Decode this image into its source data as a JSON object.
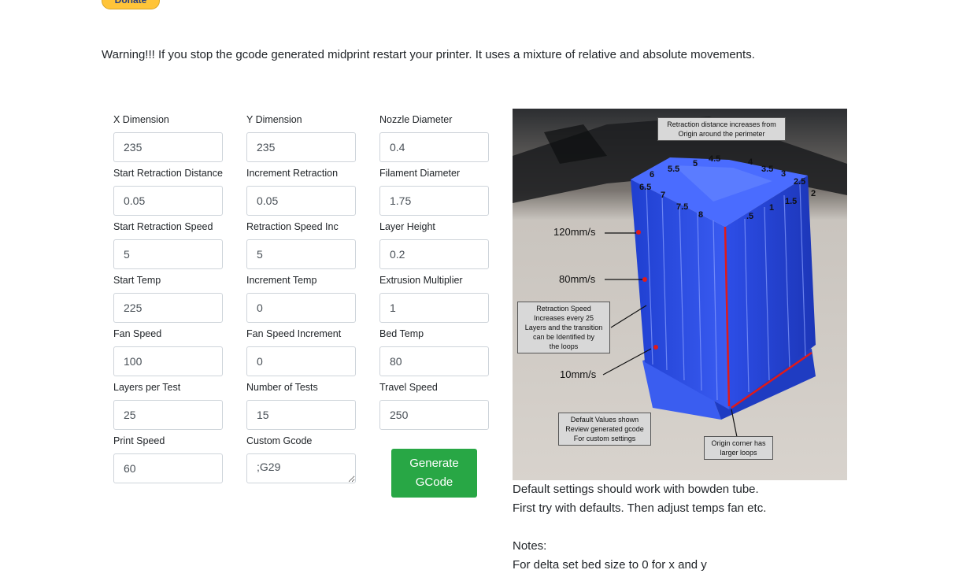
{
  "donate": {
    "label": "Donate"
  },
  "warning": "Warning!!! If you stop the gcode generated midprint restart your printer. It uses a mixture of relative and absolute movements.",
  "columns": [
    [
      {
        "label": "X Dimension",
        "value": "235"
      },
      {
        "label": "Start Retraction Distance",
        "value": "0.05"
      },
      {
        "label": "Start Retraction Speed",
        "value": "5"
      },
      {
        "label": "Start Temp",
        "value": "225"
      },
      {
        "label": "Fan Speed",
        "value": "100"
      },
      {
        "label": "Layers per Test",
        "value": "25"
      },
      {
        "label": "Print Speed",
        "value": "60"
      }
    ],
    [
      {
        "label": "Y Dimension",
        "value": "235"
      },
      {
        "label": "Increment Retraction",
        "value": "0.05"
      },
      {
        "label": "Retraction Speed Inc",
        "value": "5"
      },
      {
        "label": "Increment Temp",
        "value": "0"
      },
      {
        "label": "Fan Speed Increment",
        "value": "0"
      },
      {
        "label": "Number of Tests",
        "value": "15"
      },
      {
        "label": "Custom Gcode",
        "value": ";G29"
      }
    ],
    [
      {
        "label": "Nozzle Diameter",
        "value": "0.4"
      },
      {
        "label": "Filament Diameter",
        "value": "1.75"
      },
      {
        "label": "Layer Height",
        "value": "0.2"
      },
      {
        "label": "Extrusion Multiplier",
        "value": "1"
      },
      {
        "label": "Bed Temp",
        "value": "80"
      },
      {
        "label": "Travel Speed",
        "value": "250"
      }
    ]
  ],
  "generate": {
    "line1": "Generate",
    "line2": "GCode"
  },
  "photo": {
    "callout_top": [
      "Retraction distance increases from",
      "Origin around the perimeter"
    ],
    "callout_speed": [
      "Retraction Speed",
      "Increases every 25",
      "Layers and the transition",
      "can be Identified by",
      "the loops"
    ],
    "callout_default": [
      "Default Values shown",
      "Review generated gcode",
      "For custom settings"
    ],
    "callout_origin": [
      "Origin corner has",
      "larger loops"
    ],
    "speeds": [
      "120mm/s",
      "80mm/s",
      "10mm/s"
    ],
    "numbers": [
      "6",
      "5.5",
      "5",
      "4.5",
      "4",
      "3.5",
      "3",
      "2.5",
      "2",
      "6.5",
      "7",
      "7.5",
      "8",
      ".5",
      "1",
      "1.5"
    ]
  },
  "description": {
    "line1": "Default settings should work with bowden tube.",
    "line2": "First try with defaults. Then adjust temps fan etc.",
    "notes_title": "Notes:",
    "notes_line1": "For delta set bed size to 0 for x and y"
  },
  "colors": {
    "button": "#28a745",
    "donate": "#ffc439",
    "print": "#2a4fe0"
  }
}
